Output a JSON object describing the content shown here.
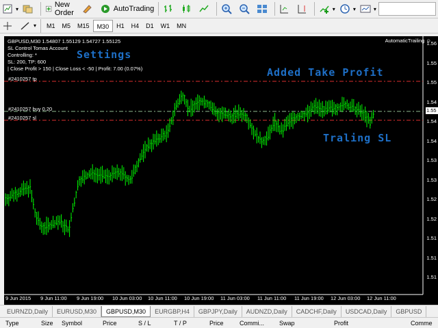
{
  "toolbar": {
    "new_order": "New Order",
    "auto_trading": "AutoTrading"
  },
  "timeframes": [
    "M1",
    "M5",
    "M15",
    "M30",
    "H1",
    "H4",
    "D1",
    "W1",
    "MN"
  ],
  "active_timeframe": "M30",
  "chart": {
    "header_line": "GBPUSD,M30  1.54807 1.55129 1.54727 1.55125",
    "ea_lines": [
      "SL Control Tomas Account",
      "Controlling: *",
      "SL: 200, TP: 600",
      "| Close Profit > 150 | Close Loss < -50 | Profit: 7.00 (0.07%)"
    ],
    "ea_name": "AutomaticTrailing",
    "overlay_settings": "Settings",
    "overlay_tp": "Added Take Profit",
    "overlay_sl": "Traling SL",
    "level_tp": "#2410257 tp",
    "level_buy": "#2410257 buy 0.20",
    "level_sl": "#2410257 sl",
    "current_price": "1.55",
    "y_ticks": [
      "1.56",
      "1.55",
      "1.55",
      "1.54",
      "1.54",
      "1.54",
      "1.53",
      "1.53",
      "1.52",
      "1.52",
      "1.51",
      "1.51",
      "1.51"
    ],
    "x_ticks": [
      "9 Jun 2015",
      "9 Jun 11:00",
      "9 Jun 19:00",
      "10 Jun 03:00",
      "10 Jun 11:00",
      "10 Jun 19:00",
      "11 Jun 03:00",
      "11 Jun 11:00",
      "11 Jun 19:00",
      "12 Jun 03:00",
      "12 Jun 11:00"
    ],
    "colors": {
      "bars": "#00ff00",
      "tp_line": "#e03030",
      "sl_line": "#e03030",
      "buy_line": "#8fbc8f",
      "overlay_text": "#1e70c8"
    }
  },
  "tabs": [
    "EURNZD,Daily",
    "EURUSD,M30",
    "GBPUSD,M30",
    "EURGBP,H4",
    "GBPJPY,Daily",
    "AUDNZD,Daily",
    "CADCHF,Daily",
    "USDCAD,Daily",
    "GBPUSD"
  ],
  "active_tab": "GBPUSD,M30",
  "terminal_columns": [
    "Type",
    "Size",
    "Symbol",
    "Price",
    "S / L",
    "T / P",
    "Price",
    "Commi...",
    "Swap",
    "Profit",
    "Comme"
  ]
}
